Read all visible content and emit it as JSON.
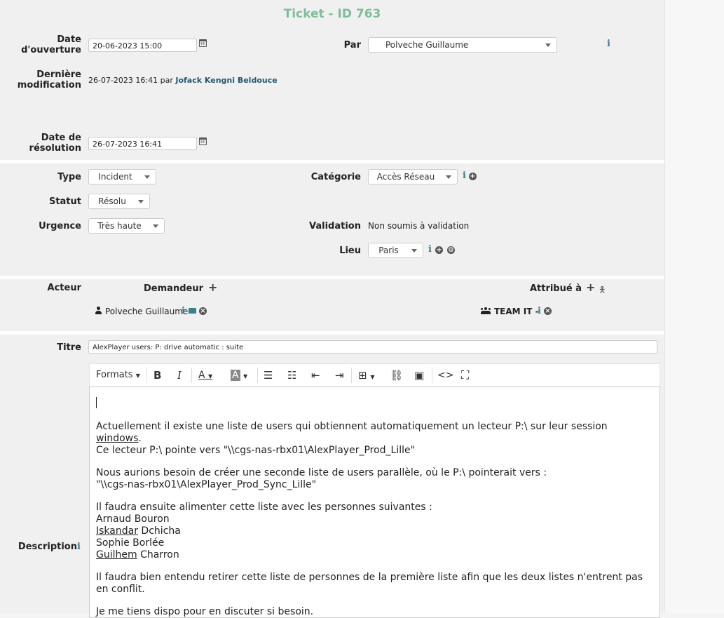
{
  "title": "Ticket - ID 763",
  "fields": {
    "date_ouverture_label_1": "Date",
    "date_ouverture_label_2": "d'ouverture",
    "date_ouverture_value": "20-06-2023 15:00",
    "par_label": "Par",
    "par_value": "Polveche Guillaume",
    "derniere_label_1": "Dernière",
    "derniere_label_2": "modification",
    "derniere_date": "26-07-2023 16:41 par",
    "derniere_user": "Jofack Kengni Beldouce",
    "resolution_label_1": "Date de",
    "resolution_label_2": "résolution",
    "resolution_value": "26-07-2023 16:41"
  },
  "classification": {
    "type_label": "Type",
    "type_value": "Incident",
    "categorie_label": "Catégorie",
    "categorie_value": "Accès Réseau",
    "statut_label": "Statut",
    "statut_value": "Résolu",
    "urgence_label": "Urgence",
    "urgence_value": "Très haute",
    "validation_label": "Validation",
    "validation_value": "Non soumis à validation",
    "lieu_label": "Lieu",
    "lieu_value": "Paris"
  },
  "actors": {
    "acteur_label": "Acteur",
    "demandeur_label": "Demandeur",
    "attribue_label": "Attribué à",
    "demandeur_name": "Polveche Guillaume",
    "attribue_name": "TEAM IT -"
  },
  "ticket": {
    "titre_label": "Titre",
    "titre_value": "AlexPlayer users: P: drive automatic : suite",
    "description_label": "Description"
  },
  "toolbar": {
    "formats_label": "Formats"
  },
  "description": {
    "p1_a": "Actuellement il existe une liste de users qui obtiennent automatiquement un lecteur P:\\ sur leur session",
    "p1_b": "windows",
    "p1_c": ".",
    "p1_d": "Ce lecteur P:\\ pointe vers \"\\\\cgs-nas-rbx01\\AlexPlayer_Prod_Lille\"",
    "p2_a": "Nous aurions besoin de créer une seconde liste de users parallèle, où le P:\\ pointerait vers :",
    "p2_b": "\"\\\\cgs-nas-rbx01\\AlexPlayer_Prod_Sync_Lille\"",
    "p3_a": "Il faudra ensuite alimenter cette liste avec les personnes suivantes :",
    "p3_b": "Arnaud Bouron",
    "p3_c1": "Iskandar",
    "p3_c2": " Dchicha",
    "p3_d": "Sophie Borlée",
    "p3_e1": "Guilhem",
    "p3_e2": " Charron",
    "p4": "Il faudra bien entendu retirer cette liste de personnes de la première liste afin que les deux listes n'entrent pas en conflit.",
    "p5": "Je me tiens dispo pour en discuter si besoin."
  },
  "colors": {
    "title": "#7dbf9a",
    "link": "#235b6e",
    "panel": "#f0f0f0"
  }
}
